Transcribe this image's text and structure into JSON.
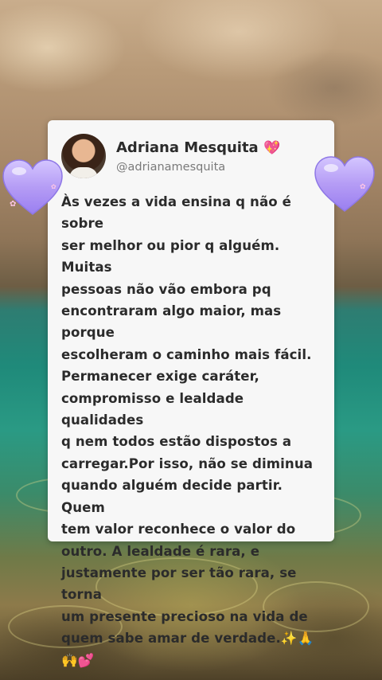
{
  "post": {
    "author_name": "Adriana Mesquita",
    "author_badge": "💖",
    "author_handle": "@adrianamesquita",
    "text": "Às vezes a vida ensina q não é sobre\nser melhor ou pior q alguém. Muitas\npessoas não vão embora pq\nencontraram algo maior, mas porque\nescolheram o caminho mais fácil.\nPermanecer exige caráter,\ncompromisso e lealdade  qualidades\nq nem todos estão dispostos a\ncarregar.Por isso, não se diminua\nquando alguém decide partir. Quem\ntem valor reconhece o valor do\noutro. A lealdade é rara, e\njustamente por ser tão rara, se torna\num presente precioso na vida de\nquem sabe amar de verdade.✨🙏\n🙌💕"
  },
  "decorations": {
    "left_heart_icon": "purple-heart-icon",
    "right_heart_icon": "purple-heart-icon",
    "heart_color": "#b59cf5",
    "card_background": "#f7f7f7"
  }
}
